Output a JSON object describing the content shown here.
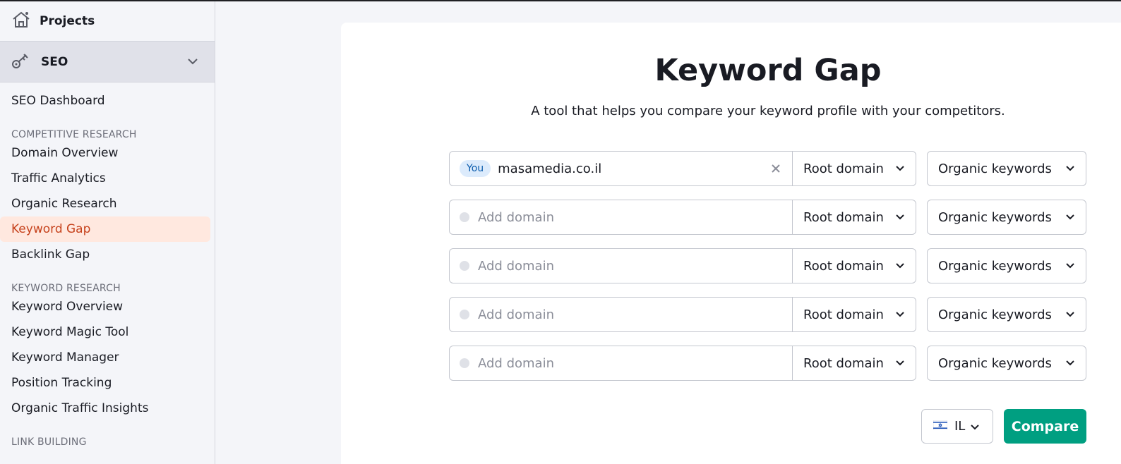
{
  "sidebar": {
    "projects_label": "Projects",
    "seo_label": "SEO",
    "dashboard": "SEO Dashboard",
    "sections": {
      "competitive": "COMPETITIVE RESEARCH",
      "keyword": "KEYWORD RESEARCH",
      "link": "LINK BUILDING"
    },
    "competitive_items": [
      "Domain Overview",
      "Traffic Analytics",
      "Organic Research",
      "Keyword Gap",
      "Backlink Gap"
    ],
    "keyword_items": [
      "Keyword Overview",
      "Keyword Magic Tool",
      "Keyword Manager",
      "Position Tracking",
      "Organic Traffic Insights"
    ],
    "active_item": "Keyword Gap"
  },
  "main": {
    "title": "Keyword Gap",
    "subtitle": "A tool that helps you compare your keyword profile with your competitors.",
    "you_badge": "You",
    "rows": [
      {
        "domain": "masamedia.co.il",
        "scope": "Root domain",
        "type": "Organic keywords"
      },
      {
        "placeholder": "Add domain",
        "scope": "Root domain",
        "type": "Organic keywords"
      },
      {
        "placeholder": "Add domain",
        "scope": "Root domain",
        "type": "Organic keywords"
      },
      {
        "placeholder": "Add domain",
        "scope": "Root domain",
        "type": "Organic keywords"
      },
      {
        "placeholder": "Add domain",
        "scope": "Root domain",
        "type": "Organic keywords"
      }
    ],
    "country_code": "IL",
    "compare_label": "Compare"
  },
  "colors": {
    "accent_active": "#c6411b",
    "active_bg": "#ffe8df",
    "compare_bg": "#009f81",
    "badge_bg": "#dcebfc"
  }
}
